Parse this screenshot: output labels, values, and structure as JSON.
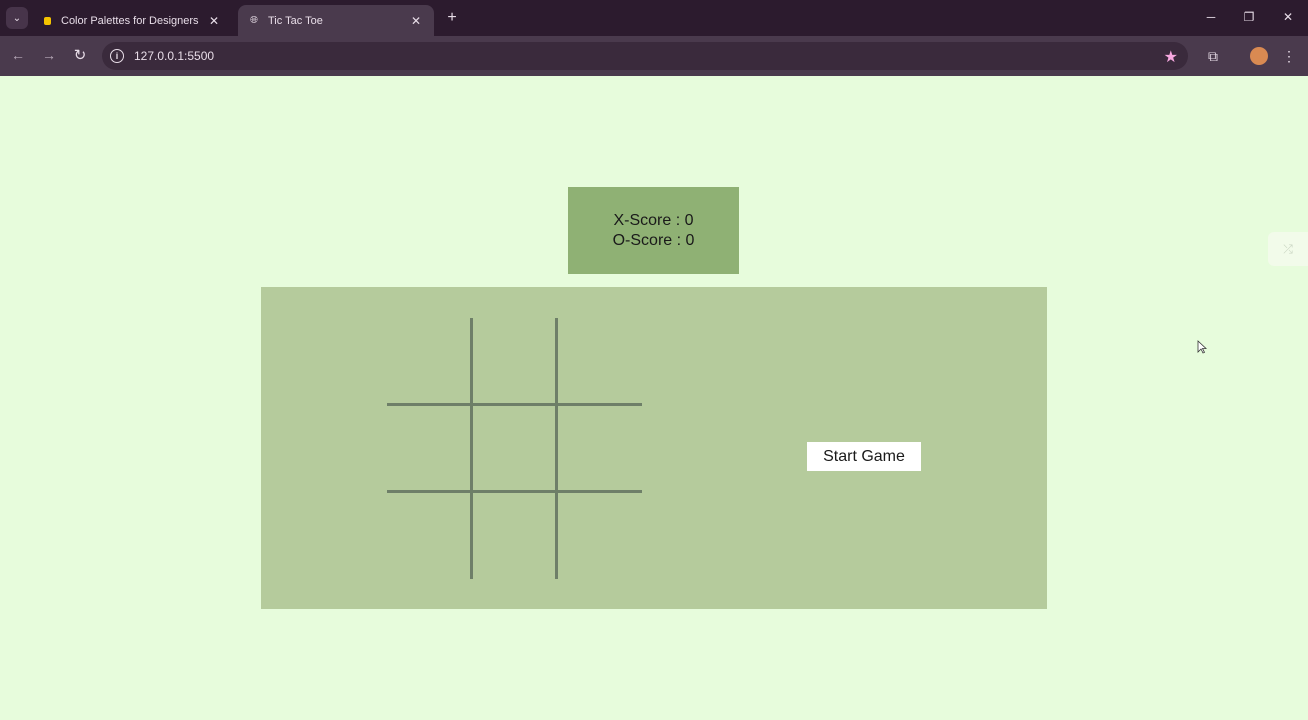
{
  "browser": {
    "tabs": [
      {
        "title": "Color Palettes for Designers and",
        "icon": "palette-favicon",
        "active": false
      },
      {
        "title": "Tic Tac Toe",
        "icon": "globe-icon",
        "active": true
      }
    ],
    "address": "127.0.0.1:5500",
    "accent": "#2c1b2e"
  },
  "score": {
    "x_label": "X-Score : 0",
    "o_label": "O-Score : 0"
  },
  "game": {
    "start_label": "Start Game"
  },
  "colors": {
    "page_background": "#e7fcdc",
    "score_box": "#8fb174",
    "game_area": "#b5cb9c",
    "grid_lines": "#6e7f68"
  }
}
